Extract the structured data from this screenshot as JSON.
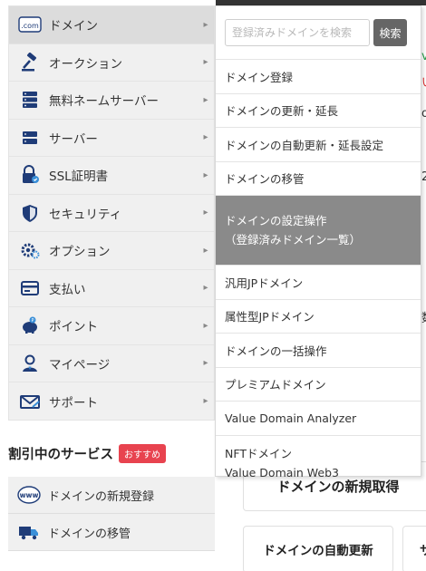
{
  "main_menu": {
    "items": [
      {
        "label": "ドメイン",
        "icon": "dotcom-icon",
        "active": true
      },
      {
        "label": "オークション",
        "icon": "gavel-icon"
      },
      {
        "label": "無料ネームサーバー",
        "icon": "server-stack-icon"
      },
      {
        "label": "サーバー",
        "icon": "server-icon"
      },
      {
        "label": "SSL証明書",
        "icon": "ssl-lock-icon"
      },
      {
        "label": "セキュリティ",
        "icon": "shield-icon"
      },
      {
        "label": "オプション",
        "icon": "gears-icon"
      },
      {
        "label": "支払い",
        "icon": "card-icon"
      },
      {
        "label": "ポイント",
        "icon": "piggy-bank-icon"
      },
      {
        "label": "マイページ",
        "icon": "user-icon"
      },
      {
        "label": "サポート",
        "icon": "mail-icon"
      }
    ],
    "arrow": "▸"
  },
  "submenu": {
    "search_placeholder": "登録済みドメインを検索",
    "search_button": "検索",
    "items": [
      {
        "label": "ドメイン登録"
      },
      {
        "label": "ドメインの更新・延長"
      },
      {
        "label": "ドメインの自動更新・延長設定"
      },
      {
        "label": "ドメインの移管"
      },
      {
        "label": "ドメインの設定操作",
        "label2": "（登録済みドメイン一覧）",
        "highlight": true
      },
      {
        "label": "汎用JPドメイン"
      },
      {
        "label": "属性型JPドメイン"
      },
      {
        "label": "ドメインの一括操作"
      },
      {
        "label": "プレミアムドメイン"
      },
      {
        "label": "Value Domain Analyzer"
      },
      {
        "label": "NFTドメイン",
        "label2": "Value Domain Web3"
      }
    ]
  },
  "services": {
    "title": "割引中のサービス",
    "badge": "おすすめ",
    "items": [
      {
        "label": "ドメインの新規登録",
        "icon": "www-icon"
      },
      {
        "label": "ドメインの移管",
        "icon": "truck-icon"
      }
    ]
  },
  "background": {
    "card_new": "ドメインの新規取得",
    "card_auto": "ドメインの自動更新",
    "edge_chars": [
      "v",
      "い",
      "o",
      "2",
      "数",
      "す",
      "サ"
    ]
  },
  "colors": {
    "menu_bg": "#f0f0f0",
    "highlight": "#8a8a8a",
    "search_button": "#666666",
    "badge": "#e8434f",
    "icon_blue": "#1f3c78"
  }
}
